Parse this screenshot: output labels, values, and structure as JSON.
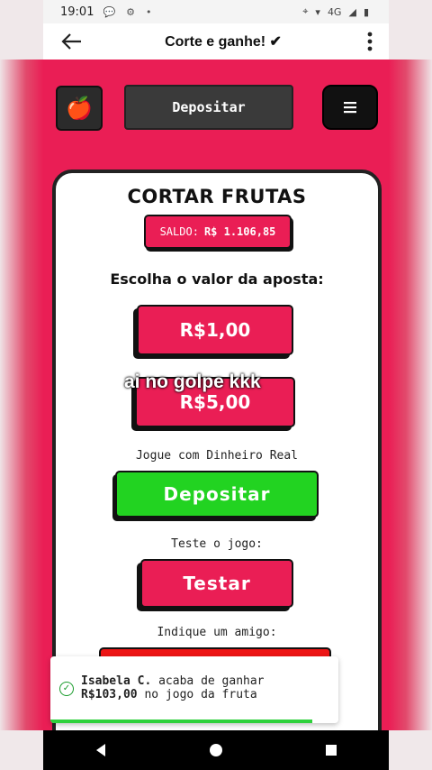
{
  "status_bar": {
    "time": "19:01",
    "network_label": "4G"
  },
  "app_bar": {
    "title": "Corte e ganhe! ✔"
  },
  "top_buttons": {
    "apple_icon": "🍎",
    "deposit_label": "Depositar",
    "menu_icon": "☰"
  },
  "card": {
    "title": "CORTAR FRUTAS",
    "saldo_prefix": "SALDO:",
    "saldo_value": "R$ 1.106,85",
    "choose_label": "Escolha o valor da aposta:",
    "bet_options": [
      "R$1,00",
      "R$5,00"
    ],
    "overlay_caption": "ai no golpe kkk",
    "real_money_label": "Jogue com Dinheiro Real",
    "deposit_button": "Depositar",
    "test_label": "Teste o jogo:",
    "test_button": "Testar",
    "refer_label": "Indique um amigo:"
  },
  "toast": {
    "name": "Isabela C.",
    "text_a": " acaba de ganhar",
    "amount": "R$103,00",
    "text_b": " no jogo da fruta",
    "progress": 0.91
  },
  "colors": {
    "brand_red": "#ea1e55",
    "green": "#22d321",
    "dark": "#111111"
  }
}
